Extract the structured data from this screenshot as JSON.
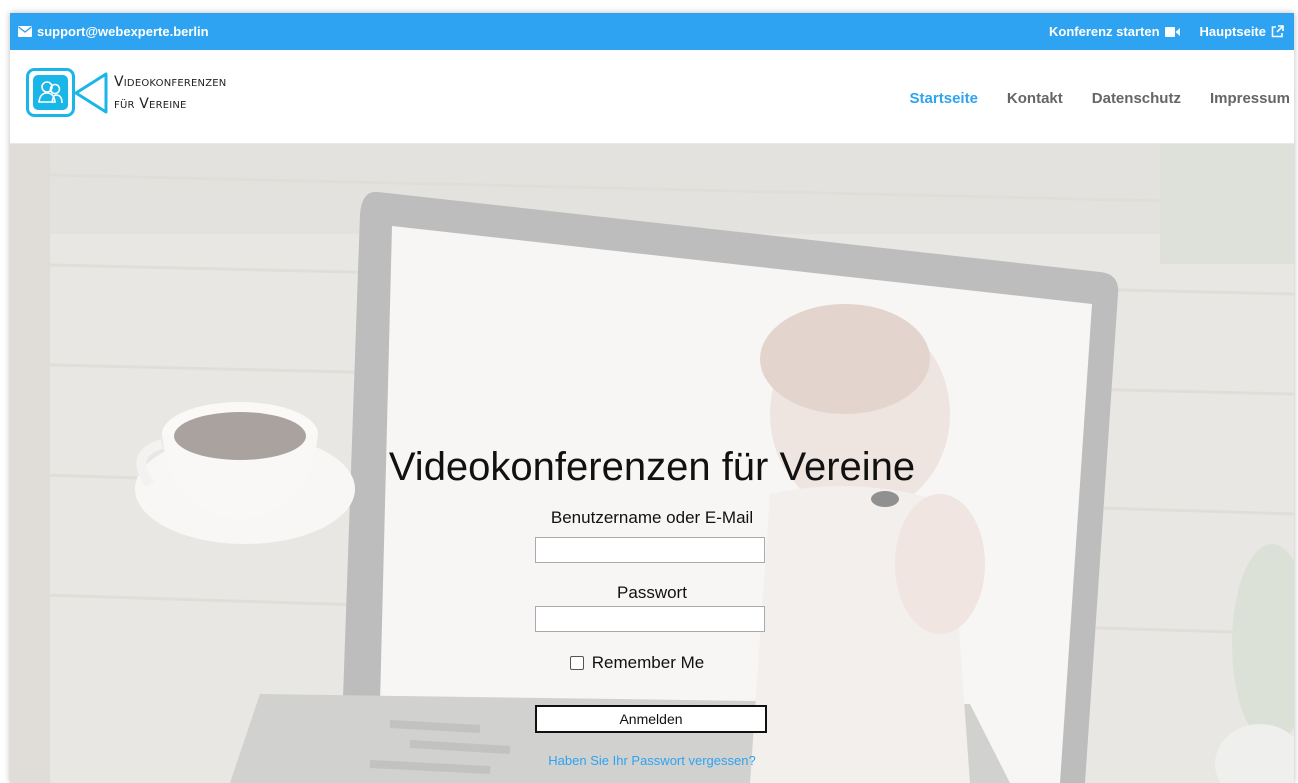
{
  "topbar": {
    "email": "support@webexperte.berlin",
    "conference_label": "Konferenz starten",
    "homepage_label": "Hauptseite"
  },
  "logo": {
    "line1": "Videokonferenzen",
    "line2": "für Vereine"
  },
  "nav": {
    "items": [
      {
        "label": "Startseite",
        "active": true
      },
      {
        "label": "Kontakt",
        "active": false
      },
      {
        "label": "Datenschutz",
        "active": false
      },
      {
        "label": "Impressum",
        "active": false
      }
    ]
  },
  "hero": {
    "title": "Videokonferenzen für Vereine"
  },
  "login": {
    "username_label": "Benutzername oder E-Mail",
    "username_value": "",
    "password_label": "Passwort",
    "password_value": "",
    "remember_label": "Remember Me",
    "remember_checked": false,
    "submit_label": "Anmelden",
    "forgot_link": "Haben Sie Ihr Passwort vergessen?"
  },
  "colors": {
    "accent": "#2ea3f2",
    "logo_cyan": "#1ab6e8",
    "nav_text": "#666666"
  },
  "icons": [
    "envelope-icon",
    "video-camera-icon",
    "external-link-icon",
    "logo-camera-icon",
    "checkbox-icon"
  ]
}
